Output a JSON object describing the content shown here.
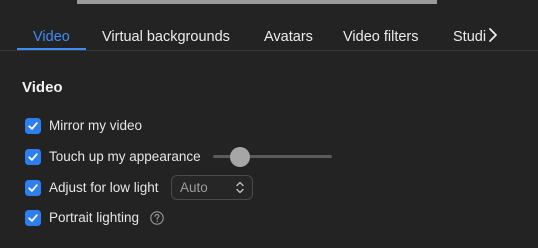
{
  "tabs": [
    {
      "label": "Video",
      "active": true
    },
    {
      "label": "Virtual backgrounds",
      "active": false
    },
    {
      "label": "Avatars",
      "active": false
    },
    {
      "label": "Video filters",
      "active": false
    },
    {
      "label": "Studi",
      "active": false
    }
  ],
  "section": {
    "title": "Video"
  },
  "options": {
    "mirror": {
      "label": "Mirror my video",
      "checked": true
    },
    "touch_up": {
      "label": "Touch up my appearance",
      "checked": true,
      "slider_level": 0.2
    },
    "low_light": {
      "label": "Adjust for low light",
      "checked": true,
      "mode": "Auto"
    },
    "portrait": {
      "label": "Portrait lighting",
      "checked": true
    }
  },
  "icons": {
    "check": "checkmark-icon",
    "tab_scroll": "chevron-right-icon",
    "select_arrows": "chevron-up-down-icon",
    "help": "question-circle-icon"
  },
  "colors": {
    "accent": "#3d8df5",
    "checkbox": "#2d7ff0",
    "background": "#232323"
  }
}
